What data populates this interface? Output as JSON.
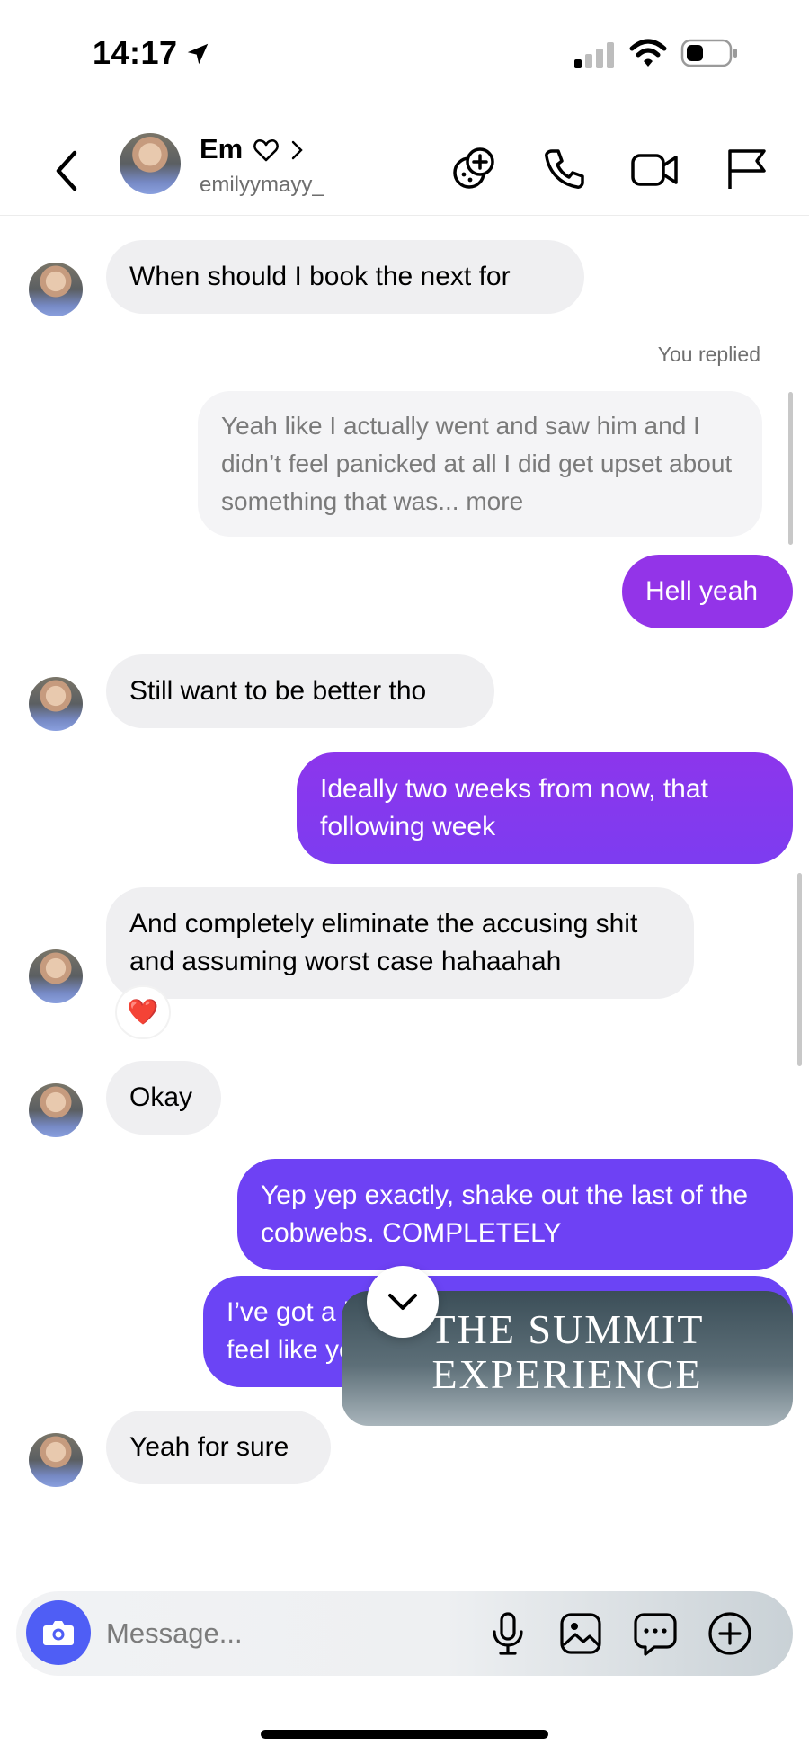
{
  "status": {
    "time": "14:17"
  },
  "header": {
    "name": "Em",
    "username": "emilyymayy_"
  },
  "messages": {
    "m1": "When should I book the next for",
    "replied_label": "You replied",
    "reply_quote": "Yeah like I actually went and saw him and I didn’t feel panicked at all I did get upset about something that was... more",
    "m2": "Hell yeah",
    "m3": "Still want to be better tho",
    "m4": "Ideally two weeks from now, that following week",
    "m5": "And completely eliminate the accusing shit and assuming worst case hahaahah",
    "m5_reaction": "❤️",
    "m6": "Okay",
    "m7": "Yep yep exactly, shake out the last of the cobwebs. COMPLETELY",
    "m8": "I’ve got a bit more of an intense audio if you feel like you’re ready for it?",
    "m9": "Yeah for sure",
    "card_line1": "THE SUMMIT",
    "card_line2": "EXPERIENCE"
  },
  "composer": {
    "placeholder": "Message..."
  },
  "colors": {
    "accent": "#4f5ef5",
    "out_top": "#9333ea",
    "out_bottom": "#6d42f5",
    "in_bubble": "#efeff1"
  }
}
